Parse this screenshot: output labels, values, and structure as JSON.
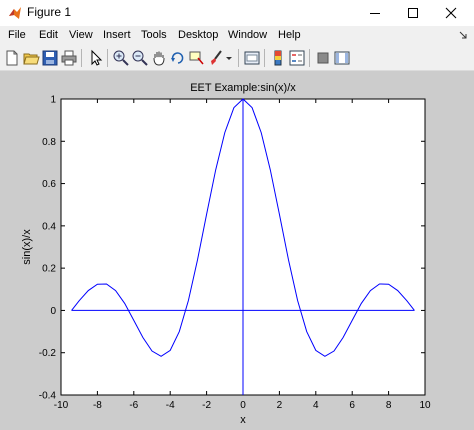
{
  "window": {
    "title": "Figure 1",
    "controls": {
      "minimize": "minimize-icon",
      "maximize": "maximize-icon",
      "close": "close-icon"
    }
  },
  "menu": {
    "items": [
      {
        "label": "File"
      },
      {
        "label": "Edit"
      },
      {
        "label": "View"
      },
      {
        "label": "Insert"
      },
      {
        "label": "Tools"
      },
      {
        "label": "Desktop"
      },
      {
        "label": "Window"
      },
      {
        "label": "Help"
      }
    ]
  },
  "toolbar": {
    "icons": [
      "new-figure-icon",
      "open-file-icon",
      "save-icon",
      "print-icon",
      "pointer-icon",
      "zoom-in-icon",
      "zoom-out-icon",
      "pan-icon",
      "rotate-icon",
      "data-cursor-icon",
      "brush-icon",
      "link-plot-icon",
      "insert-colorbar-icon",
      "insert-legend-icon",
      "hide-plot-tools-icon",
      "show-plot-tools-icon"
    ]
  },
  "colors": {
    "line": "#0000ff",
    "figure_bg": "#cccccc",
    "axes_bg": "#ffffff"
  },
  "chart_data": {
    "type": "line",
    "title": "EET Example:sin(x)/x",
    "xlabel": "x",
    "ylabel": "sin(x)/x",
    "xlim": [
      -10,
      10
    ],
    "ylim": [
      -0.4,
      1
    ],
    "xticks": [
      -10,
      -8,
      -6,
      -4,
      -2,
      0,
      2,
      4,
      6,
      8,
      10
    ],
    "yticks": [
      -0.4,
      -0.2,
      0,
      0.2,
      0.4,
      0.6,
      0.8,
      1
    ],
    "grid": false,
    "series": [
      {
        "color": "#0000ff",
        "x": [
          -9.42,
          -9.0,
          -8.5,
          -8.0,
          -7.5,
          -7.0,
          -6.5,
          -6.0,
          -5.5,
          -5.0,
          -4.5,
          -4.0,
          -3.5,
          -3.0,
          -2.5,
          -2.0,
          -1.5,
          -1.0,
          -0.5,
          0.0,
          0.5,
          1.0,
          1.5,
          2.0,
          2.5,
          3.0,
          3.5,
          4.0,
          4.5,
          5.0,
          5.5,
          6.0,
          6.5,
          7.0,
          7.5,
          8.0,
          8.5,
          9.0,
          9.42
        ],
        "y": [
          0.0,
          0.046,
          0.094,
          0.124,
          0.125,
          0.094,
          0.033,
          -0.047,
          -0.128,
          -0.192,
          -0.217,
          -0.189,
          -0.1,
          0.047,
          0.239,
          0.455,
          0.665,
          0.841,
          0.959,
          1.0,
          0.959,
          0.841,
          0.665,
          0.455,
          0.239,
          0.047,
          -0.1,
          -0.189,
          -0.217,
          -0.192,
          -0.128,
          -0.047,
          0.033,
          0.094,
          0.125,
          0.124,
          0.094,
          0.046,
          0.0
        ]
      },
      {
        "color": "#0000ff",
        "x": [
          -9.42,
          9.42
        ],
        "y": [
          0,
          0
        ]
      },
      {
        "color": "#0000ff",
        "x": [
          0,
          0
        ],
        "y": [
          -0.4,
          1
        ]
      }
    ]
  }
}
